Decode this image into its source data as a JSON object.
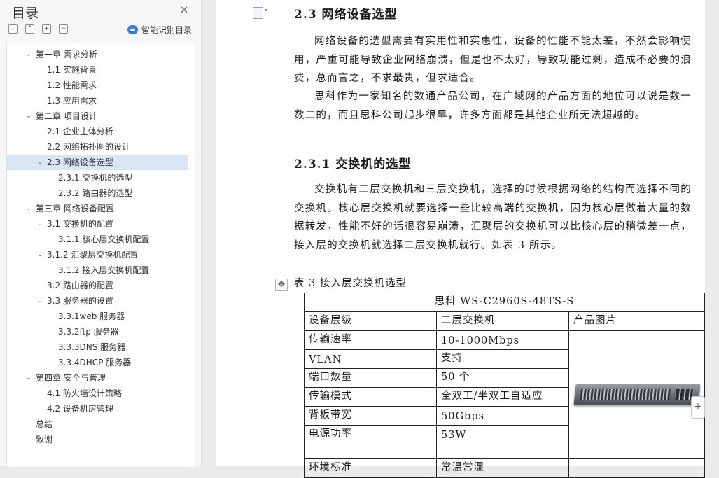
{
  "sidebar": {
    "title": "目录",
    "close_icon": "×",
    "tools": [
      "⌄",
      "⌃",
      "+",
      "−"
    ],
    "smart_toc_label": "智能识别目录",
    "items": [
      {
        "label": "第一章 需求分析",
        "level": 1,
        "arrow": "⌄"
      },
      {
        "label": "1.1 实施背景",
        "level": 2,
        "arrow": ""
      },
      {
        "label": "1.2 性能需求",
        "level": 2,
        "arrow": ""
      },
      {
        "label": "1.3 应用需求",
        "level": 2,
        "arrow": ""
      },
      {
        "label": "第二章 项目设计",
        "level": 1,
        "arrow": "⌄"
      },
      {
        "label": "2.1 企业主体分析",
        "level": 2,
        "arrow": ""
      },
      {
        "label": "2.2 网络拓扑图的设计",
        "level": 2,
        "arrow": ""
      },
      {
        "label": "2.3 网络设备选型",
        "level": 2,
        "arrow": "⌄",
        "active": true
      },
      {
        "label": "2.3.1 交换机的选型",
        "level": 3,
        "arrow": ""
      },
      {
        "label": "2.3.2 路由器的选型",
        "level": 3,
        "arrow": ""
      },
      {
        "label": "第三章 网络设备配置",
        "level": 1,
        "arrow": "⌄"
      },
      {
        "label": "3.1 交换机的配置",
        "level": 2,
        "arrow": "⌄"
      },
      {
        "label": "3.1.1 核心层交换机配置",
        "level": 3,
        "arrow": ""
      },
      {
        "label": "3.1.2 汇聚层交换机配置",
        "level": 2,
        "arrow": "⌄"
      },
      {
        "label": "3.1.2 接入层交换机配置",
        "level": 3,
        "arrow": ""
      },
      {
        "label": "3.2 路由器的配置",
        "level": 2,
        "arrow": ""
      },
      {
        "label": "3.3 服务器的设置",
        "level": 2,
        "arrow": "⌄"
      },
      {
        "label": "3.3.1web 服务器",
        "level": 3,
        "arrow": ""
      },
      {
        "label": "3.3.2ftp 服务器",
        "level": 3,
        "arrow": ""
      },
      {
        "label": "3.3.3DNS 服务器",
        "level": 3,
        "arrow": ""
      },
      {
        "label": "3.3.4DHCP 服务器",
        "level": 3,
        "arrow": ""
      },
      {
        "label": "第四章 安全与管理",
        "level": 1,
        "arrow": "⌄"
      },
      {
        "label": "4.1 防火墙设计策略",
        "level": 2,
        "arrow": ""
      },
      {
        "label": "4.2 设备机房管理",
        "level": 2,
        "arrow": ""
      },
      {
        "label": "总结",
        "level": 1,
        "arrow": ""
      },
      {
        "label": "致谢",
        "level": 1,
        "arrow": ""
      }
    ]
  },
  "document": {
    "heading_23": "2.3 网络设备选型",
    "para1": "网络设备的选型需要有实用性和实惠性，设备的性能不能太差，不然会影响使用，严重可能导致企业网络崩溃，但是也不太好，导致功能过剩，造成不必要的浪费，总而言之，不求最贵，但求适合。",
    "para2": "思科作为一家知名的数通产品公司，在广域网的产品方面的地位可以说是数一数二的，而且思科公司起步很早，许多方面都是其他企业所无法超越的。",
    "heading_231": "2.3.1 交换机的选型",
    "para3": "交换机有二层交换机和三层交换机，选择的时候根据网络的结构而选择不同的交换机。核心层交换机就要选择一些比较高端的交换机，因为核心层做着大量的数据转发，性能不好的话很容易崩溃，汇聚层的交换机可以比核心层的稍微差一点，接入层的交换机就选择二层交换机就行。如表 3 所示。",
    "table_caption": "表 3  接入层交换机选型",
    "move_icon": "✥",
    "plus_icon": "+",
    "table": {
      "title": "思科   WS-C2960S-48TS-S",
      "header": {
        "label": "设备层级",
        "value": "二层交换机",
        "image_label": "产品图片"
      },
      "rows": [
        {
          "label": "传输速率",
          "value": "10-1000Mbps"
        },
        {
          "label": "VLAN",
          "value": "支持"
        },
        {
          "label": "端口数量",
          "value": "50 个"
        },
        {
          "label": "传输模式",
          "value": "全双工/半双工自适应"
        },
        {
          "label": "背板带宽",
          "value": "50Gbps"
        },
        {
          "label": "电源功率",
          "value": "53W"
        }
      ],
      "partial_row": {
        "label": "环境标准",
        "value": "常温常湿"
      }
    }
  }
}
